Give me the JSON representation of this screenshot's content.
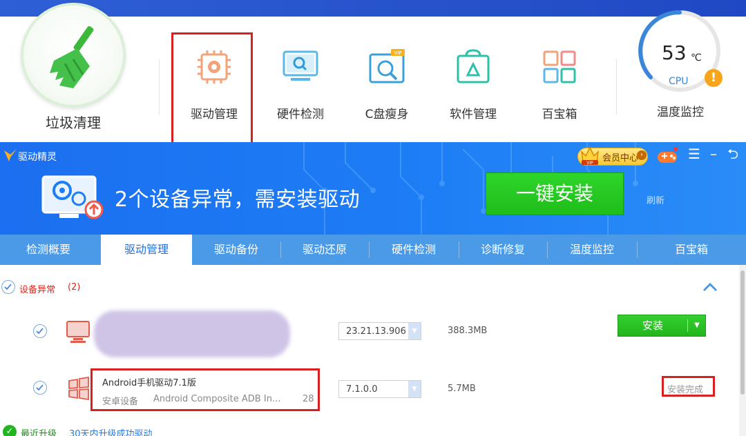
{
  "toolbar": {
    "cleanup_label": "垃圾清理",
    "tools": [
      {
        "label": "驱动管理",
        "icon": "chip-gear-icon",
        "color": "#f2a37a"
      },
      {
        "label": "硬件检测",
        "icon": "monitor-search-icon",
        "color": "#5ab8e8"
      },
      {
        "label": "C盘瘦身",
        "icon": "disk-magnifier-icon",
        "color": "#3aa0dc",
        "badge": "VIP"
      },
      {
        "label": "软件管理",
        "icon": "store-triangle-icon",
        "color": "#2cc0a8"
      },
      {
        "label": "百宝箱",
        "icon": "grid-boxes-icon",
        "color": "#f2a37a"
      }
    ],
    "active_tool": "驱动管理",
    "temperature": {
      "value": "53",
      "unit": "℃",
      "sensor": "CPU",
      "warning": "!",
      "label": "温度监控"
    }
  },
  "app": {
    "name": "驱动精灵",
    "vip_label": "会员中心",
    "vip_badge": "VIP",
    "menu_glyph": "☰",
    "minimize_glyph": "–",
    "close_glyph": "⮌",
    "message": "2个设备异常，需安装驱动",
    "install_all_label": "一键安装",
    "refresh_label": "刷新"
  },
  "tabs": [
    {
      "label": "检测概要",
      "active": false
    },
    {
      "label": "驱动管理",
      "active": true
    },
    {
      "label": "驱动备份",
      "active": false
    },
    {
      "label": "驱动还原",
      "active": false
    },
    {
      "label": "硬件检测",
      "active": false
    },
    {
      "label": "诊断修复",
      "active": false
    },
    {
      "label": "温度监控",
      "active": false
    },
    {
      "label": "百宝箱",
      "active": false
    }
  ],
  "section": {
    "title": "设备异常",
    "count": "(2)"
  },
  "devices": [
    {
      "version": "23.21.13.906",
      "size": "388.3MB",
      "action_label": "安装",
      "icon": "monitor-icon"
    },
    {
      "name": "Android手机驱动7.1版",
      "category": "安卓设备",
      "description": "Android Composite ADB In...",
      "number": "28",
      "version": "7.1.0.0",
      "size": "5.7MB",
      "status": "安装完成",
      "icon": "windows-logo-icon"
    }
  ],
  "recent": {
    "title": "最近升级",
    "description": "30天内升级成功驱动"
  },
  "colors": {
    "header_blue": "#1d7df5",
    "tab_blue": "#4a9ae8",
    "install_green": "#23b51e",
    "highlight_red": "#d9201f",
    "alert_red": "#e1251b"
  }
}
